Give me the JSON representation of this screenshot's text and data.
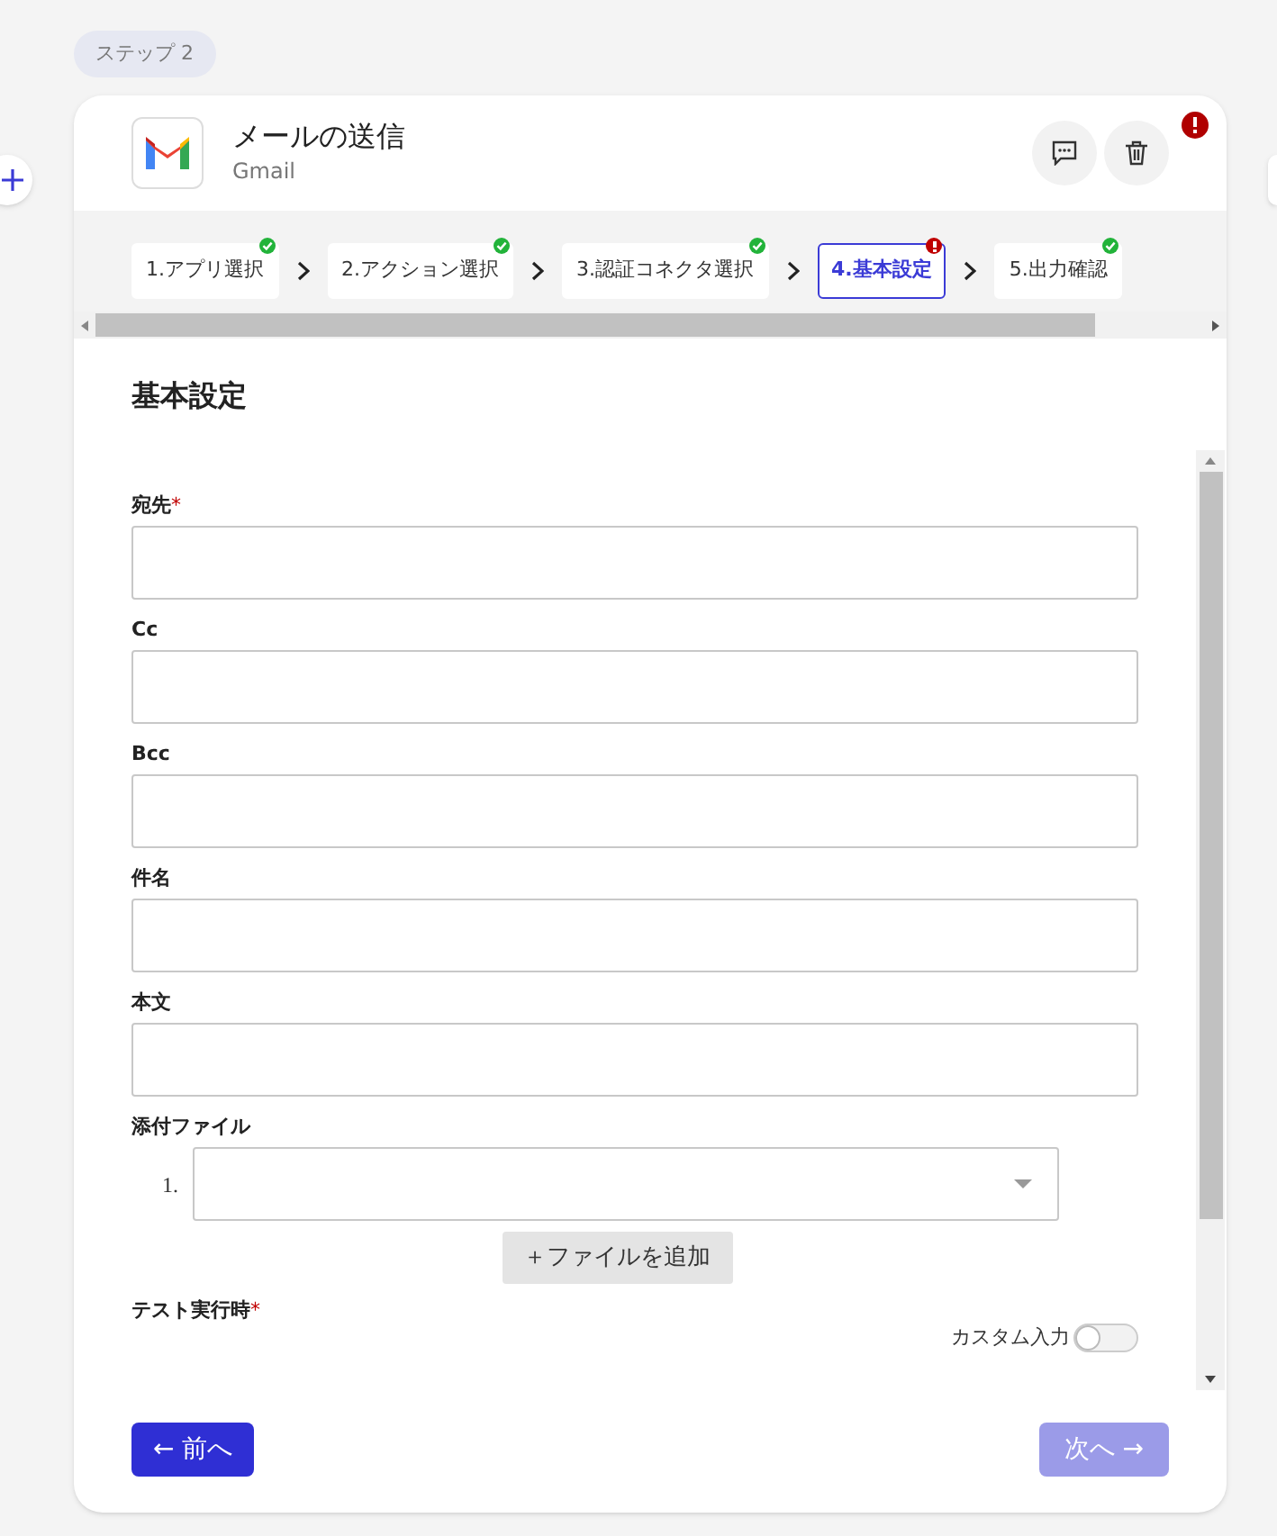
{
  "step_badge": "ステップ 2",
  "header": {
    "title": "メールの送信",
    "subtitle": "Gmail",
    "has_error": true
  },
  "steps": [
    {
      "label": "1.アプリ選択",
      "selected": false,
      "completed": true,
      "error": false
    },
    {
      "label": "2.アクション選択",
      "selected": false,
      "completed": true,
      "error": false
    },
    {
      "label": "3.認証コネクタ選択",
      "selected": false,
      "completed": true,
      "error": false
    },
    {
      "label": "4.基本設定",
      "selected": true,
      "completed": false,
      "error": true
    },
    {
      "label": "5.出力確認",
      "selected": false,
      "completed": true,
      "error": false
    }
  ],
  "section_title": "基本設定",
  "fields": [
    {
      "label": "宛先",
      "required_mark": "*"
    },
    {
      "label": "Cc"
    },
    {
      "label": "Bcc"
    },
    {
      "label": "件名"
    },
    {
      "label": "本文"
    }
  ],
  "attachments": {
    "label": "添付ファイル",
    "items": [
      {
        "number": "1."
      }
    ],
    "add_button": "＋ファイルを追加"
  },
  "test_run": {
    "label": "テスト実行時",
    "required_mark": "*",
    "toggle_label": "カスタム入力",
    "on": false
  },
  "footer": {
    "prev": "← 前へ",
    "next": {
      "label": "次へ →",
      "disabled": true
    }
  }
}
